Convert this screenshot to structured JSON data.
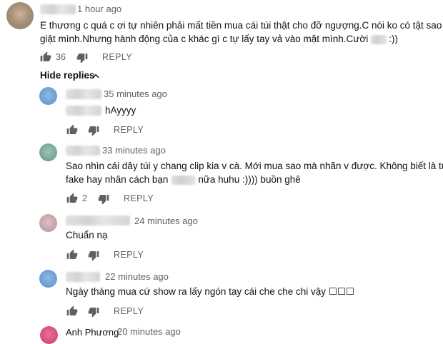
{
  "main_comment": {
    "time": "1 hour ago",
    "text_line1": "E thương c quá c ơi tự nhiên phải mất tiền mua cái túi thật cho đỡ ngượng.C nói ko có tật sao phải",
    "text_line2_a": "giật mình.Nhưng hành động của c khác gì c tự lấy tay vả vào mặt mình.Cười",
    "text_line2_b": ":))",
    "likes": "36",
    "reply_label": "REPLY",
    "like_icon": "thumbs-up-icon",
    "dislike_icon": "thumbs-down-icon"
  },
  "hide_replies": {
    "label": "Hide replies",
    "icon": "chevron-up-icon"
  },
  "replies": [
    {
      "time": "35 minutes ago",
      "text": "hAyyyy",
      "likes": "",
      "reply_label": "REPLY",
      "avatar_color": "#6f9fd6"
    },
    {
      "time": "33 minutes ago",
      "text_line1": "Sao nhìn cái dây túi y chang clip kia v cà. Mới mua sao mà nhãn v được. Không biết là túi",
      "text_line2_a": "fake hay nhân cách bạn",
      "text_line2_b": "nữa huhu :)))) buồn ghê",
      "likes": "2",
      "reply_label": "REPLY",
      "avatar_color": "#7aa898"
    },
    {
      "time": "24 minutes ago",
      "text": "Chuẩn nạ",
      "likes": "",
      "reply_label": "REPLY",
      "avatar_color": "#c6a6a8"
    },
    {
      "time": "22 minutes ago",
      "text": "Ngày tháng mua cứ show ra lấy ngón tay cái che che chi vậy ☐☐☐",
      "likes": "",
      "reply_label": "REPLY",
      "avatar_color": "#6f9fd6"
    },
    {
      "author": "Anh Phương",
      "time": "20 minutes ago",
      "avatar_color": "#d8527e"
    }
  ]
}
